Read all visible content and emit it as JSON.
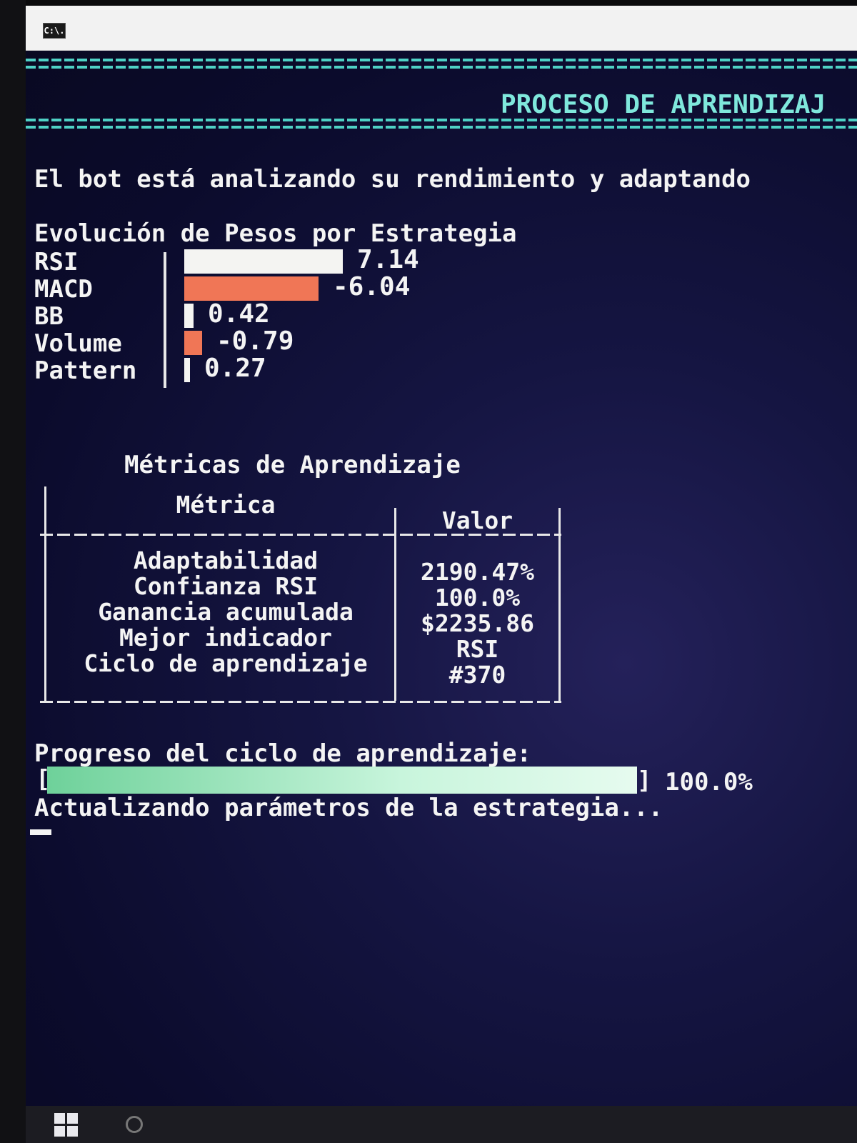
{
  "window": {
    "icon_text": "C:\\."
  },
  "banner": {
    "title": "PROCESO DE APRENDIZAJ"
  },
  "status_line": "El bot está analizando su rendimiento y adaptando",
  "weights": {
    "heading": "Evolución de Pesos por Estrategia",
    "rows": [
      {
        "label": "RSI",
        "value": "7.14",
        "num": 7.14
      },
      {
        "label": "MACD",
        "value": "-6.04",
        "num": -6.04
      },
      {
        "label": "BB",
        "value": "0.42",
        "num": 0.42
      },
      {
        "label": "Volume",
        "value": "-0.79",
        "num": -0.79
      },
      {
        "label": "Pattern",
        "value": "0.27",
        "num": 0.27
      }
    ],
    "positive_color": "#f4f4f2",
    "negative_color": "#f07656"
  },
  "metrics": {
    "title": "Métricas de Aprendizaje",
    "col_metric": "Métrica",
    "col_value": "Valor",
    "rows": [
      {
        "name": "Adaptabilidad",
        "value": "2190.47%"
      },
      {
        "name": "Confianza RSI",
        "value": "100.0%"
      },
      {
        "name": "Ganancia acumulada",
        "value": "$2235.86"
      },
      {
        "name": "Mejor indicador",
        "value": "RSI"
      },
      {
        "name": "Ciclo de aprendizaje",
        "value": "#370"
      }
    ]
  },
  "progress": {
    "label": "Progreso del ciclo de aprendizaje:",
    "open_bracket": "[",
    "close_bracket": "]",
    "fraction": 1.0,
    "percent_text": "100.0%",
    "status": "Actualizando parámetros de la estrategia..."
  },
  "colors": {
    "banner": "#7fe8dc",
    "progress_fill": "#c8f5dc"
  }
}
